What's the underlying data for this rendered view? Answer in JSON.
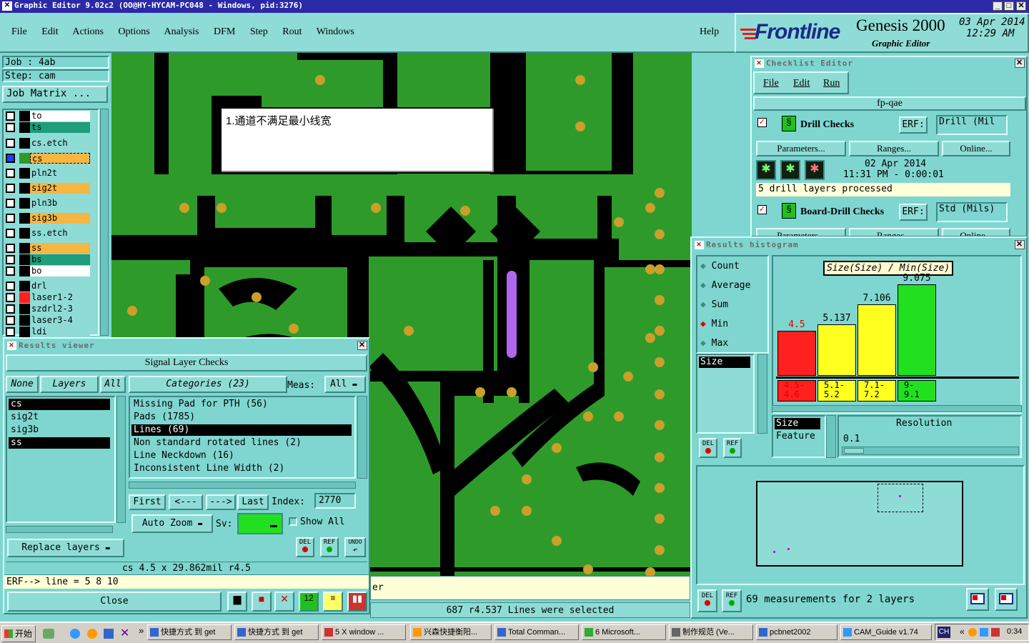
{
  "window": {
    "title": "Graphic Editor 9.02c2  (OO@HY-HYCAM-PC048 - Windows, pid:3276)"
  },
  "menubar": [
    "File",
    "Edit",
    "Actions",
    "Options",
    "Analysis",
    "DFM",
    "Step",
    "Rout",
    "Windows"
  ],
  "help_label": "Help",
  "brand": {
    "logo": "Frontline",
    "product": "Genesis 2000",
    "subtitle": "Graphic Editor",
    "date": "03 Apr 2014",
    "time": "12:29 AM"
  },
  "job": {
    "job": "Job : 4ab",
    "step": "Step: cam",
    "matrix_button": "Job Matrix ..."
  },
  "layers": [
    {
      "name": "to",
      "color": "#ffffff",
      "swatch": "#000000"
    },
    {
      "name": "ts",
      "color": "#1e9e7a",
      "swatch": "#000000"
    },
    {
      "name": "cs.etch",
      "color": "#8fdcd6",
      "swatch": "#000000"
    },
    {
      "name": "cs",
      "color": "#f5b642",
      "swatch": "#2e9a2a",
      "active": true
    },
    {
      "name": "pln2t",
      "color": "#8fdcd6",
      "swatch": "#000000"
    },
    {
      "name": "sig2t",
      "color": "#f5b642",
      "swatch": "#000000"
    },
    {
      "name": "pln3b",
      "color": "#8fdcd6",
      "swatch": "#000000"
    },
    {
      "name": "sig3b",
      "color": "#f5b642",
      "swatch": "#000000"
    },
    {
      "name": "ss.etch",
      "color": "#8fdcd6",
      "swatch": "#000000"
    },
    {
      "name": "ss",
      "color": "#f5b642",
      "swatch": "#000000"
    },
    {
      "name": "bs",
      "color": "#1e9e7a",
      "swatch": "#000000"
    },
    {
      "name": "bo",
      "color": "#ffffff",
      "swatch": "#000000"
    },
    {
      "name": "drl",
      "color": "#8fdcd6",
      "swatch": "#000000"
    },
    {
      "name": "laser1-2",
      "color": "#8fdcd6",
      "swatch": "#ff2020"
    },
    {
      "name": "szdrl2-3",
      "color": "#8fdcd6",
      "swatch": "#000000"
    },
    {
      "name": "laser3-4",
      "color": "#8fdcd6",
      "swatch": "#000000"
    },
    {
      "name": "ldi",
      "color": "#8fdcd6",
      "swatch": "#000000"
    }
  ],
  "annotation": "1.通道不满足最小线宽",
  "checklist": {
    "title": "Checklist Editor",
    "menu": [
      "File",
      "Edit",
      "Run"
    ],
    "name": "fp-qae",
    "checks": [
      {
        "name": "Drill Checks",
        "erf_label": "ERF:",
        "erf": "Drill (Mil",
        "buttons": [
          "Parameters...",
          "Ranges...",
          "Online..."
        ],
        "date": "02 Apr 2014",
        "time": "11:31 PM - 0:00:01",
        "status": "5 drill layers processed"
      },
      {
        "name": "Board-Drill Checks",
        "erf_label": "ERF:",
        "erf": "Std (Mils)",
        "buttons": [
          "Parameters...",
          "Ranges...",
          "Online..."
        ]
      }
    ]
  },
  "histogram": {
    "title": "Results histogram",
    "modes": [
      "Count",
      "Average",
      "Sum",
      "Min",
      "Max"
    ],
    "selected_mode": "Min",
    "list_item": "Size",
    "chart_title": "Size(Size) / Min(Size)",
    "bars": [
      {
        "value": "4.5",
        "range": "4.5-\n4.6",
        "color": "#ff2020",
        "label_color": "#e00000"
      },
      {
        "value": "5.137",
        "range": "5.1-\n5.2",
        "color": "#ffff20",
        "label_color": "#000000"
      },
      {
        "value": "7.106",
        "range": "7.1-\n7.2",
        "color": "#ffff20",
        "label_color": "#000000"
      },
      {
        "value": "9.075",
        "range": "9-\n9.1",
        "color": "#20e020",
        "label_color": "#000000"
      }
    ],
    "axis_list": [
      "Size",
      "Feature"
    ],
    "resolution_label": "Resolution",
    "resolution_value": "0.1",
    "del_label": "DEL",
    "ref_label": "REF",
    "summary": "69 measurements for 2 layers"
  },
  "results_viewer": {
    "title": "Results viewer",
    "header": "Signal Layer Checks",
    "none_btn": "None",
    "layers_btn": "Layers",
    "all_btn": "All",
    "layers": [
      "cs",
      "sig2t",
      "sig3b",
      "ss"
    ],
    "selected_layers": [
      "cs",
      "ss"
    ],
    "categories_btn": "Categories (23)",
    "meas_label": "Meas:",
    "meas_value": "All",
    "categories": [
      "Missing Pad for PTH (56)",
      "Pads (1785)",
      "Lines (69)",
      "Non standard rotated lines (2)",
      "Line Neckdown (16)",
      "Inconsistent Line Width (2)"
    ],
    "selected_category": "Lines (69)",
    "nav": [
      "First",
      "<---",
      "--->",
      "Last"
    ],
    "index_label": "Index:",
    "index_value": "2770",
    "auto_zoom": "Auto Zoom",
    "sv_label": "Sv:",
    "show_all": "Show All",
    "replace_layers": "Replace layers",
    "del_label": "DEL",
    "ref_label": "REF",
    "undo_label": "UNDO",
    "feature_line": "cs 4.5 x 29.862mil  r4.5",
    "erf_line": "ERF--> line = 5 8 10",
    "close": "Close"
  },
  "status": {
    "partial": "er",
    "selection": "687 r4.537 Lines were selected"
  },
  "taskbar": {
    "start": "开始",
    "items": [
      "快捷方式 到 get",
      "快捷方式 到 get",
      "5 X window ...",
      "兴森快捷衡阳...",
      "Total Comman...",
      "6 Microsoft...",
      "制作规范 (Ve...",
      "pcbnet2002",
      "CAM_Guide v1.74"
    ],
    "lang": "CH",
    "clock": "0:34"
  }
}
